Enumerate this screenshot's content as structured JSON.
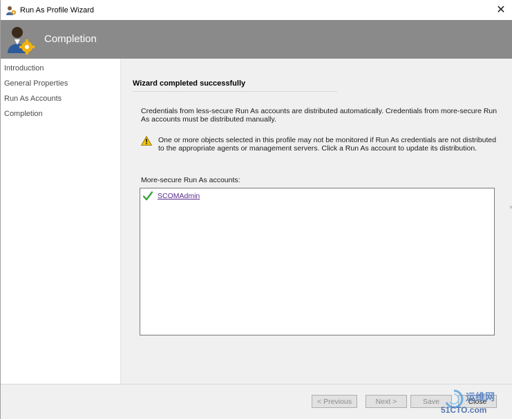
{
  "window": {
    "title": "Run As Profile Wizard",
    "close_glyph": "✕"
  },
  "header": {
    "title": "Completion",
    "icon": "user-gear-icon"
  },
  "nav": {
    "items": [
      {
        "label": "Introduction"
      },
      {
        "label": "General Properties"
      },
      {
        "label": "Run As Accounts"
      },
      {
        "label": "Completion"
      }
    ]
  },
  "main": {
    "section_title": "Wizard completed successfully",
    "description": "Credentials from less-secure Run As accounts are distributed automatically. Credentials from more-secure Run As accounts must be distributed manually.",
    "warning": "One or more objects selected in this profile may not be monitored if Run As credentials are not distributed to the appropriate agents or management servers. Click a Run As account to update its distribution.",
    "list_label": "More-secure Run As accounts:",
    "accounts": [
      {
        "name": "SCOMAdmin",
        "status_icon": "green-check-icon"
      }
    ]
  },
  "buttons": {
    "previous": "< Previous",
    "next": "Next >",
    "save": "Save",
    "close": "Close"
  },
  "watermark": {
    "line1": "运维网",
    "line2": "51CTO.com"
  },
  "colors": {
    "header_bg": "#8a8a8a",
    "content_bg": "#f0f0f0",
    "link": "#5a2b8a",
    "check": "#3aa33a",
    "warning": "#f2c200"
  }
}
